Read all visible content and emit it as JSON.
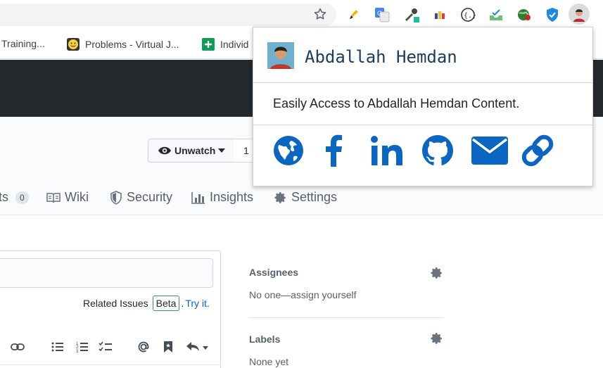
{
  "bookmarks": [
    {
      "label": "Training..."
    },
    {
      "label": "Problems - Virtual J..."
    },
    {
      "label": "Individ"
    }
  ],
  "repo": {
    "unwatch_label": "Unwatch",
    "watch_count": "1"
  },
  "tabs": [
    {
      "label": "ts",
      "counter": "0"
    },
    {
      "label": "Wiki"
    },
    {
      "label": "Security"
    },
    {
      "label": "Insights"
    },
    {
      "label": "Settings"
    }
  ],
  "issue_form": {
    "related_label": "Related Issues",
    "beta_badge": "Beta",
    "try_link": "Try it."
  },
  "sidebar": {
    "assignees_heading": "Assignees",
    "assignees_value": "No one—assign yourself",
    "labels_heading": "Labels",
    "labels_value": "None yet"
  },
  "popup": {
    "name": "Abdallah Hemdan",
    "description": "Easily Access to Abdallah Hemdan Content.",
    "links": [
      "website-icon",
      "facebook-icon",
      "linkedin-icon",
      "github-icon",
      "email-icon",
      "link-icon"
    ],
    "accent": "#0b66c2"
  },
  "colors": {
    "header_dark": "#24292e",
    "link_blue": "#0366d6",
    "beta_green": "#28a745"
  }
}
